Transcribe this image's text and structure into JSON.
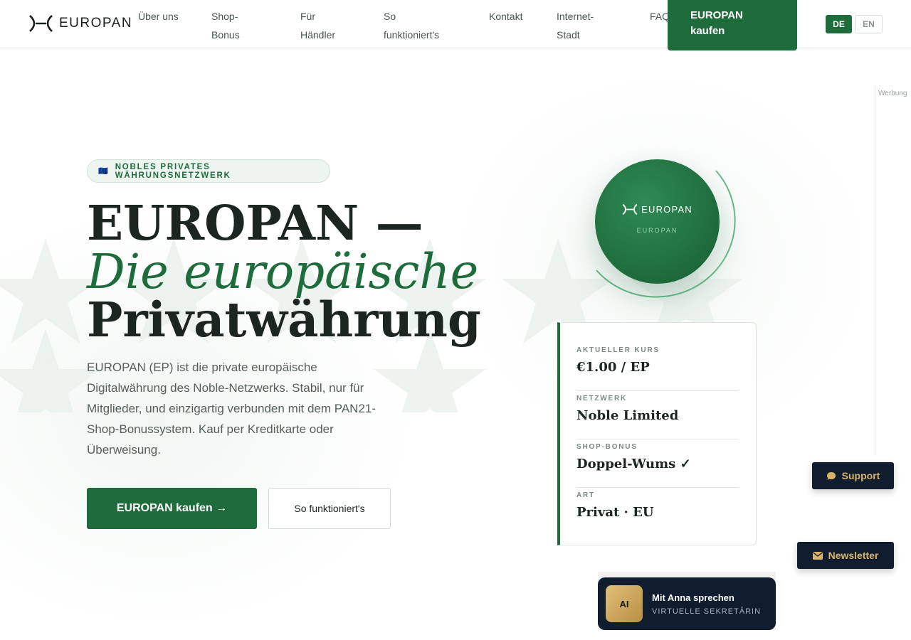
{
  "header": {
    "brand": "EUROPAN",
    "nav": [
      {
        "label": "Über uns"
      },
      {
        "label": "Shop-Bonus"
      },
      {
        "label": "Für Händler"
      },
      {
        "label": "So funktioniert's"
      },
      {
        "label": "Kontakt"
      },
      {
        "label": "Internet-Stadt"
      },
      {
        "label": "FAQ"
      }
    ],
    "cta": "EUROPAN kaufen",
    "languages": [
      "DE",
      "EN"
    ],
    "active_language": "DE"
  },
  "ad": {
    "label": "Werbung"
  },
  "hero": {
    "badge_flag": "🇪🇺",
    "badge": "NOBLES PRIVATES WÄHRUNGSNETZWERK",
    "title_line1": "EUROPAN —",
    "title_line2": "Die europäische",
    "title_line3": "Privatwährung",
    "lead": "EUROPAN (EP) ist die private europäische Digitalwährung des Noble-Netzwerks. Stabil, nur für Mitglieder, und einzigartig verbunden mit dem PAN21-Shop-Bonussystem. Kauf per Kreditkarte oder Überweisung.",
    "primary_button": "EUROPAN kaufen →",
    "secondary_button": "So funktioniert's"
  },
  "coin": {
    "brand": "EUROPAN",
    "caption": "EUROPAN"
  },
  "info_card": {
    "rows": [
      {
        "label": "AKTUELLER KURS",
        "value": "€1.00 / EP"
      },
      {
        "label": "NETZWERK",
        "value": "Noble Limited"
      },
      {
        "label": "SHOP-BONUS",
        "value": "Doppel-Wums ✓"
      },
      {
        "label": "ART",
        "value": "Privat · EU"
      }
    ]
  },
  "floating": {
    "support": "Support",
    "newsletter": "Newsletter"
  },
  "assistant": {
    "avatar": "AI",
    "title": "Mit Anna sprechen",
    "subtitle": "VIRTUELLE SEKRETÄRIN"
  },
  "colors": {
    "brand_green": "#1e6b3c",
    "navy": "#0f1d2e",
    "gold": "#d9b36a"
  }
}
